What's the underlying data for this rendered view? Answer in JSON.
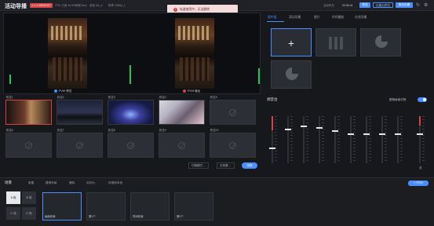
{
  "app": {
    "title": "活动导播",
    "tag": "1.1.1-20230117",
    "stats": [
      "CPU 占用 34.5%",
      "网络 8ms",
      "丢帧 0/s_s",
      "码率 1080p_1"
    ],
    "clock": "00:36:41",
    "clock_label": "活动时长 ",
    "buttons": [
      "预览",
      "设置后预览",
      "推流设置"
    ]
  },
  "toast": {
    "text": "轨道使用中，无法删除"
  },
  "preview": {
    "pvw_label": "PVW 预览",
    "pgm_label": "PGM 输出"
  },
  "sources": [
    {
      "label": "机位1"
    },
    {
      "label": "机位2"
    },
    {
      "label": "机位3"
    },
    {
      "label": "机位4"
    },
    {
      "label": "机位5"
    },
    {
      "label": "机位6"
    },
    {
      "label": "机位7"
    },
    {
      "label": "机位8"
    }
  ],
  "source_empty": [
    "机位9",
    "机位10",
    "机位11",
    "机位12",
    "机位13"
  ],
  "transition": {
    "mode": "切换模式",
    "effect": "无效果",
    "cut_label": "切换"
  },
  "tabs": [
    "画中画",
    "滑动导播",
    "图片",
    "时间播放",
    "在线导播"
  ],
  "mixer": {
    "title": "调音台",
    "follow_label": "跟随画面切换",
    "master_label": "总"
  },
  "layout": {
    "title": "场景",
    "toolbar": [
      "新建",
      "替换布局",
      "删除",
      "另存为",
      "存储到本地"
    ],
    "ab": [
      "A 场",
      "B 场",
      "C 场",
      "D 场"
    ],
    "cards": [
      "画面布局",
      "第1个",
      "时间布局",
      "第2个"
    ],
    "add_label": "+ PVW",
    "card_badge": "无信号"
  },
  "colors": {
    "accent": "#4a8eff",
    "danger": "#d64545",
    "signal": "#22c55e"
  }
}
